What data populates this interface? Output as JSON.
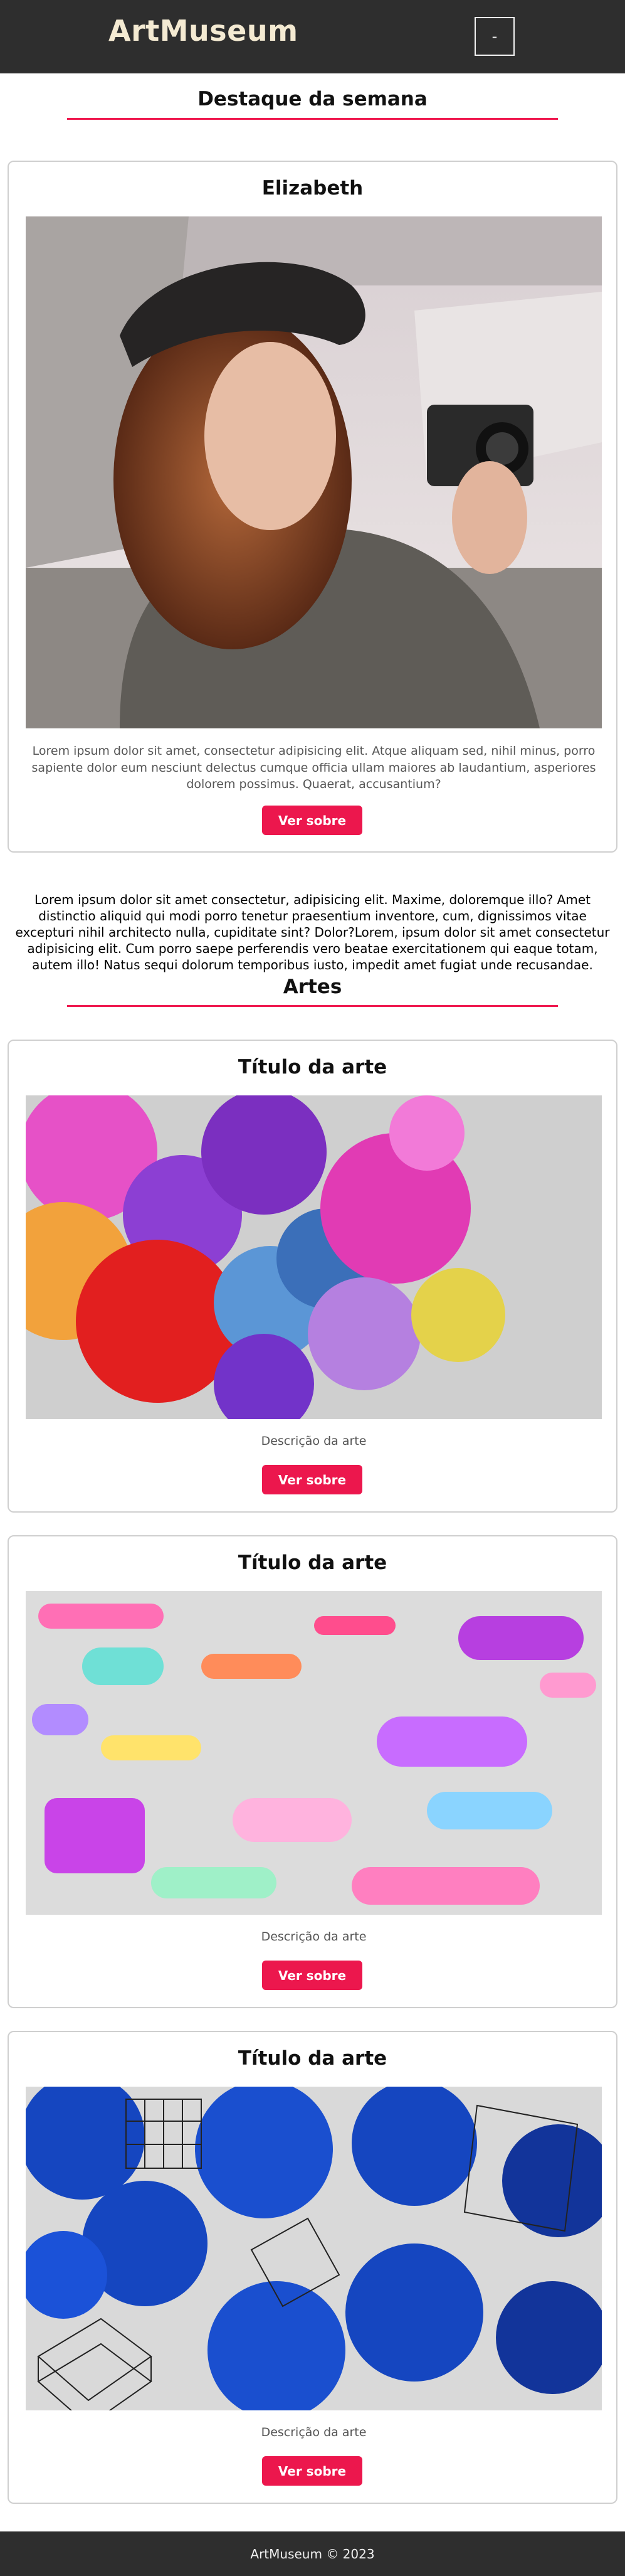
{
  "header": {
    "brand": "ArtMuseum",
    "menu_label": "-"
  },
  "featured": {
    "heading": "Destaque da semana",
    "card": {
      "title": "Elizabeth",
      "image": "portrait of woman with camera",
      "text": "Lorem ipsum dolor sit amet, consectetur adipisicing elit. Atque aliquam sed, nihil minus, porro sapiente dolor eum nesciunt delectus cumque officia ullam maiores ab laudantium, asperiores dolorem possimus. Quaerat, accusantium?",
      "button": "Ver sobre"
    }
  },
  "intro_text": "Lorem ipsum dolor sit amet consectetur, adipisicing elit. Maxime, doloremque illo? Amet distinctio aliquid qui modi porro tenetur praesentium inventore, cum, dignissimos vitae excepturi nihil architecto nulla, cupiditate sint? Dolor?Lorem, ipsum dolor sit amet consectetur adipisicing elit. Cum porro saepe perferendis vero beatae exercitationem qui eaque totam, autem illo! Natus sequi dolorum temporibus iusto, impedit amet fugiat unde recusandae.",
  "arts": {
    "heading": "Artes",
    "cards": [
      {
        "title": "Título da arte",
        "image": "colorful 3D blobs",
        "description": "Descrição da arte",
        "button": "Ver sobre"
      },
      {
        "title": "Título da arte",
        "image": "colorful 3D spirals",
        "description": "Descrição da arte",
        "button": "Ver sobre"
      },
      {
        "title": "Título da arte",
        "image": "blue 3D shapes with wireframes",
        "description": "Descrição da arte",
        "button": "Ver sobre"
      }
    ]
  },
  "footer": {
    "text": "ArtMuseum © 2023"
  }
}
